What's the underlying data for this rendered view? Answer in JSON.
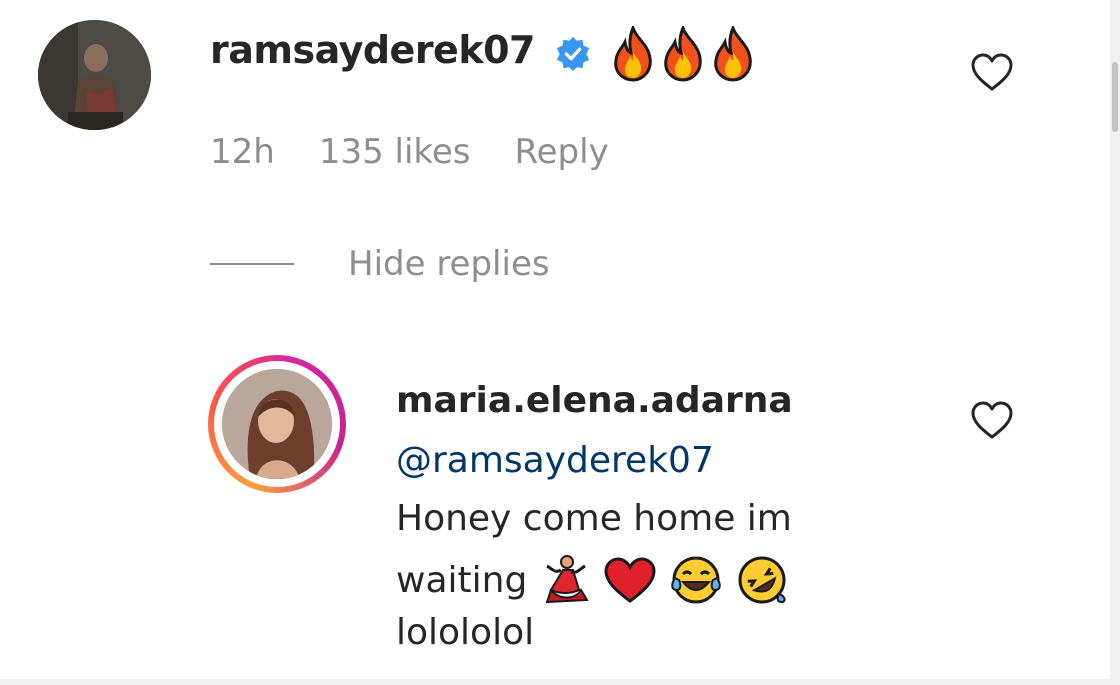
{
  "comment": {
    "username": "ramsayderek07",
    "verified": true,
    "emoji": [
      "fire-icon",
      "fire-icon",
      "fire-icon"
    ],
    "time": "12h",
    "likes": "135 likes",
    "reply_label": "Reply",
    "hide_replies_label": "Hide replies"
  },
  "reply": {
    "username": "maria.elena.adarna",
    "mention": "@ramsayderek07",
    "line1": "Honey come home im",
    "line2": "waiting",
    "line2_emoji": [
      "dancer-icon",
      "red-heart-icon",
      "tears-of-joy-icon",
      "rolling-laughing-icon"
    ],
    "line3": "lolololol"
  },
  "colors": {
    "text_primary": "#262626",
    "text_secondary": "#8e8e8e",
    "mention": "#00376b",
    "verified_blue": "#3897f0",
    "heart_outline": "#262626"
  }
}
